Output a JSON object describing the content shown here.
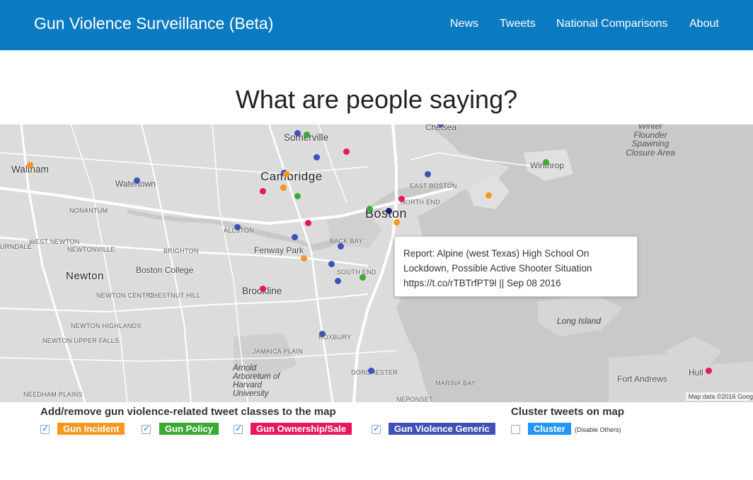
{
  "navbar": {
    "brand": "Gun Violence Surveillance (Beta)",
    "items": [
      {
        "label": "News"
      },
      {
        "label": "Tweets"
      },
      {
        "label": "National Comparisons"
      },
      {
        "label": "About"
      }
    ],
    "color": "#0b7bc1"
  },
  "heading": "What are people saying?",
  "map": {
    "places": {
      "chelsea": "Chelsea",
      "somerville": "Somerville",
      "waltham": "Waltham",
      "watertown": "Watertown",
      "cambridge": "Cambridge",
      "east_boston": "EAST BOSTON",
      "winthrop": "Winthrop",
      "north_end": "NORTH END",
      "boston": "Boston",
      "nonantum": "NONANTUM",
      "allston": "ALLSTON",
      "back_bay": "BACK BAY",
      "urndale": "URNDALE",
      "west_newton": "WEST NEWTON",
      "newtonville": "NEWTONVILLE",
      "brighton": "BRIGHTON",
      "fenway_park": "Fenway Park",
      "newton": "Newton",
      "boston_college": "Boston College",
      "south_end": "SOUTH END",
      "newton_centre": "NEWTON CENTRE",
      "chestnut_hill": "CHESTNUT HILL",
      "brookline": "Brookline",
      "long_island": "Long Island",
      "newton_highlands": "NEWTON HIGHLANDS",
      "newton_upper_falls": "NEWTON UPPER FALLS",
      "roxbury": "ROXBURY",
      "jamaica_plain": "JAMAICA PLAIN",
      "arnold_arboretum": "Arnold Arboretum of Harvard University",
      "dorchester": "DORCHESTER",
      "hull": "Hull",
      "fort_andrews": "Fort Andrews",
      "marina_bay": "MARINA BAY",
      "needham_plains": "NEEDHAM PLAINS",
      "neponset": "NEPONSET",
      "winter_flounder": "Winter Flounder Spawning Closure Area"
    },
    "popup": {
      "line1": "Report: Alpine (west Texas) High School On",
      "line2": "Lockdown, Possible Active Shooter Situation",
      "line3": "https://t.co/rTBTrfPT9l || Sep 08 2016"
    },
    "attribution": "Map data ©2016 Goog",
    "colors": {
      "incident": "#f6981e",
      "policy": "#3aaa35",
      "ownership": "#e8175d",
      "generic": "#3f51b5",
      "highlight": "#1a1a6e"
    }
  },
  "controls": {
    "classes_title": "Add/remove gun violence-related tweet classes to the map",
    "cluster_title": "Cluster tweets on map",
    "classes": [
      {
        "label": "Gun Incident",
        "checked": true,
        "color": "#f6981e"
      },
      {
        "label": "Gun Policy",
        "checked": true,
        "color": "#3aaa35"
      },
      {
        "label": "Gun Ownership/Sale",
        "checked": true,
        "color": "#e8175d"
      },
      {
        "label": "Gun Violence Generic",
        "checked": true,
        "color": "#3f51b5"
      }
    ],
    "cluster": {
      "label": "Cluster",
      "checked": false,
      "color": "#2196f3",
      "note": "(Disable Others)"
    }
  }
}
